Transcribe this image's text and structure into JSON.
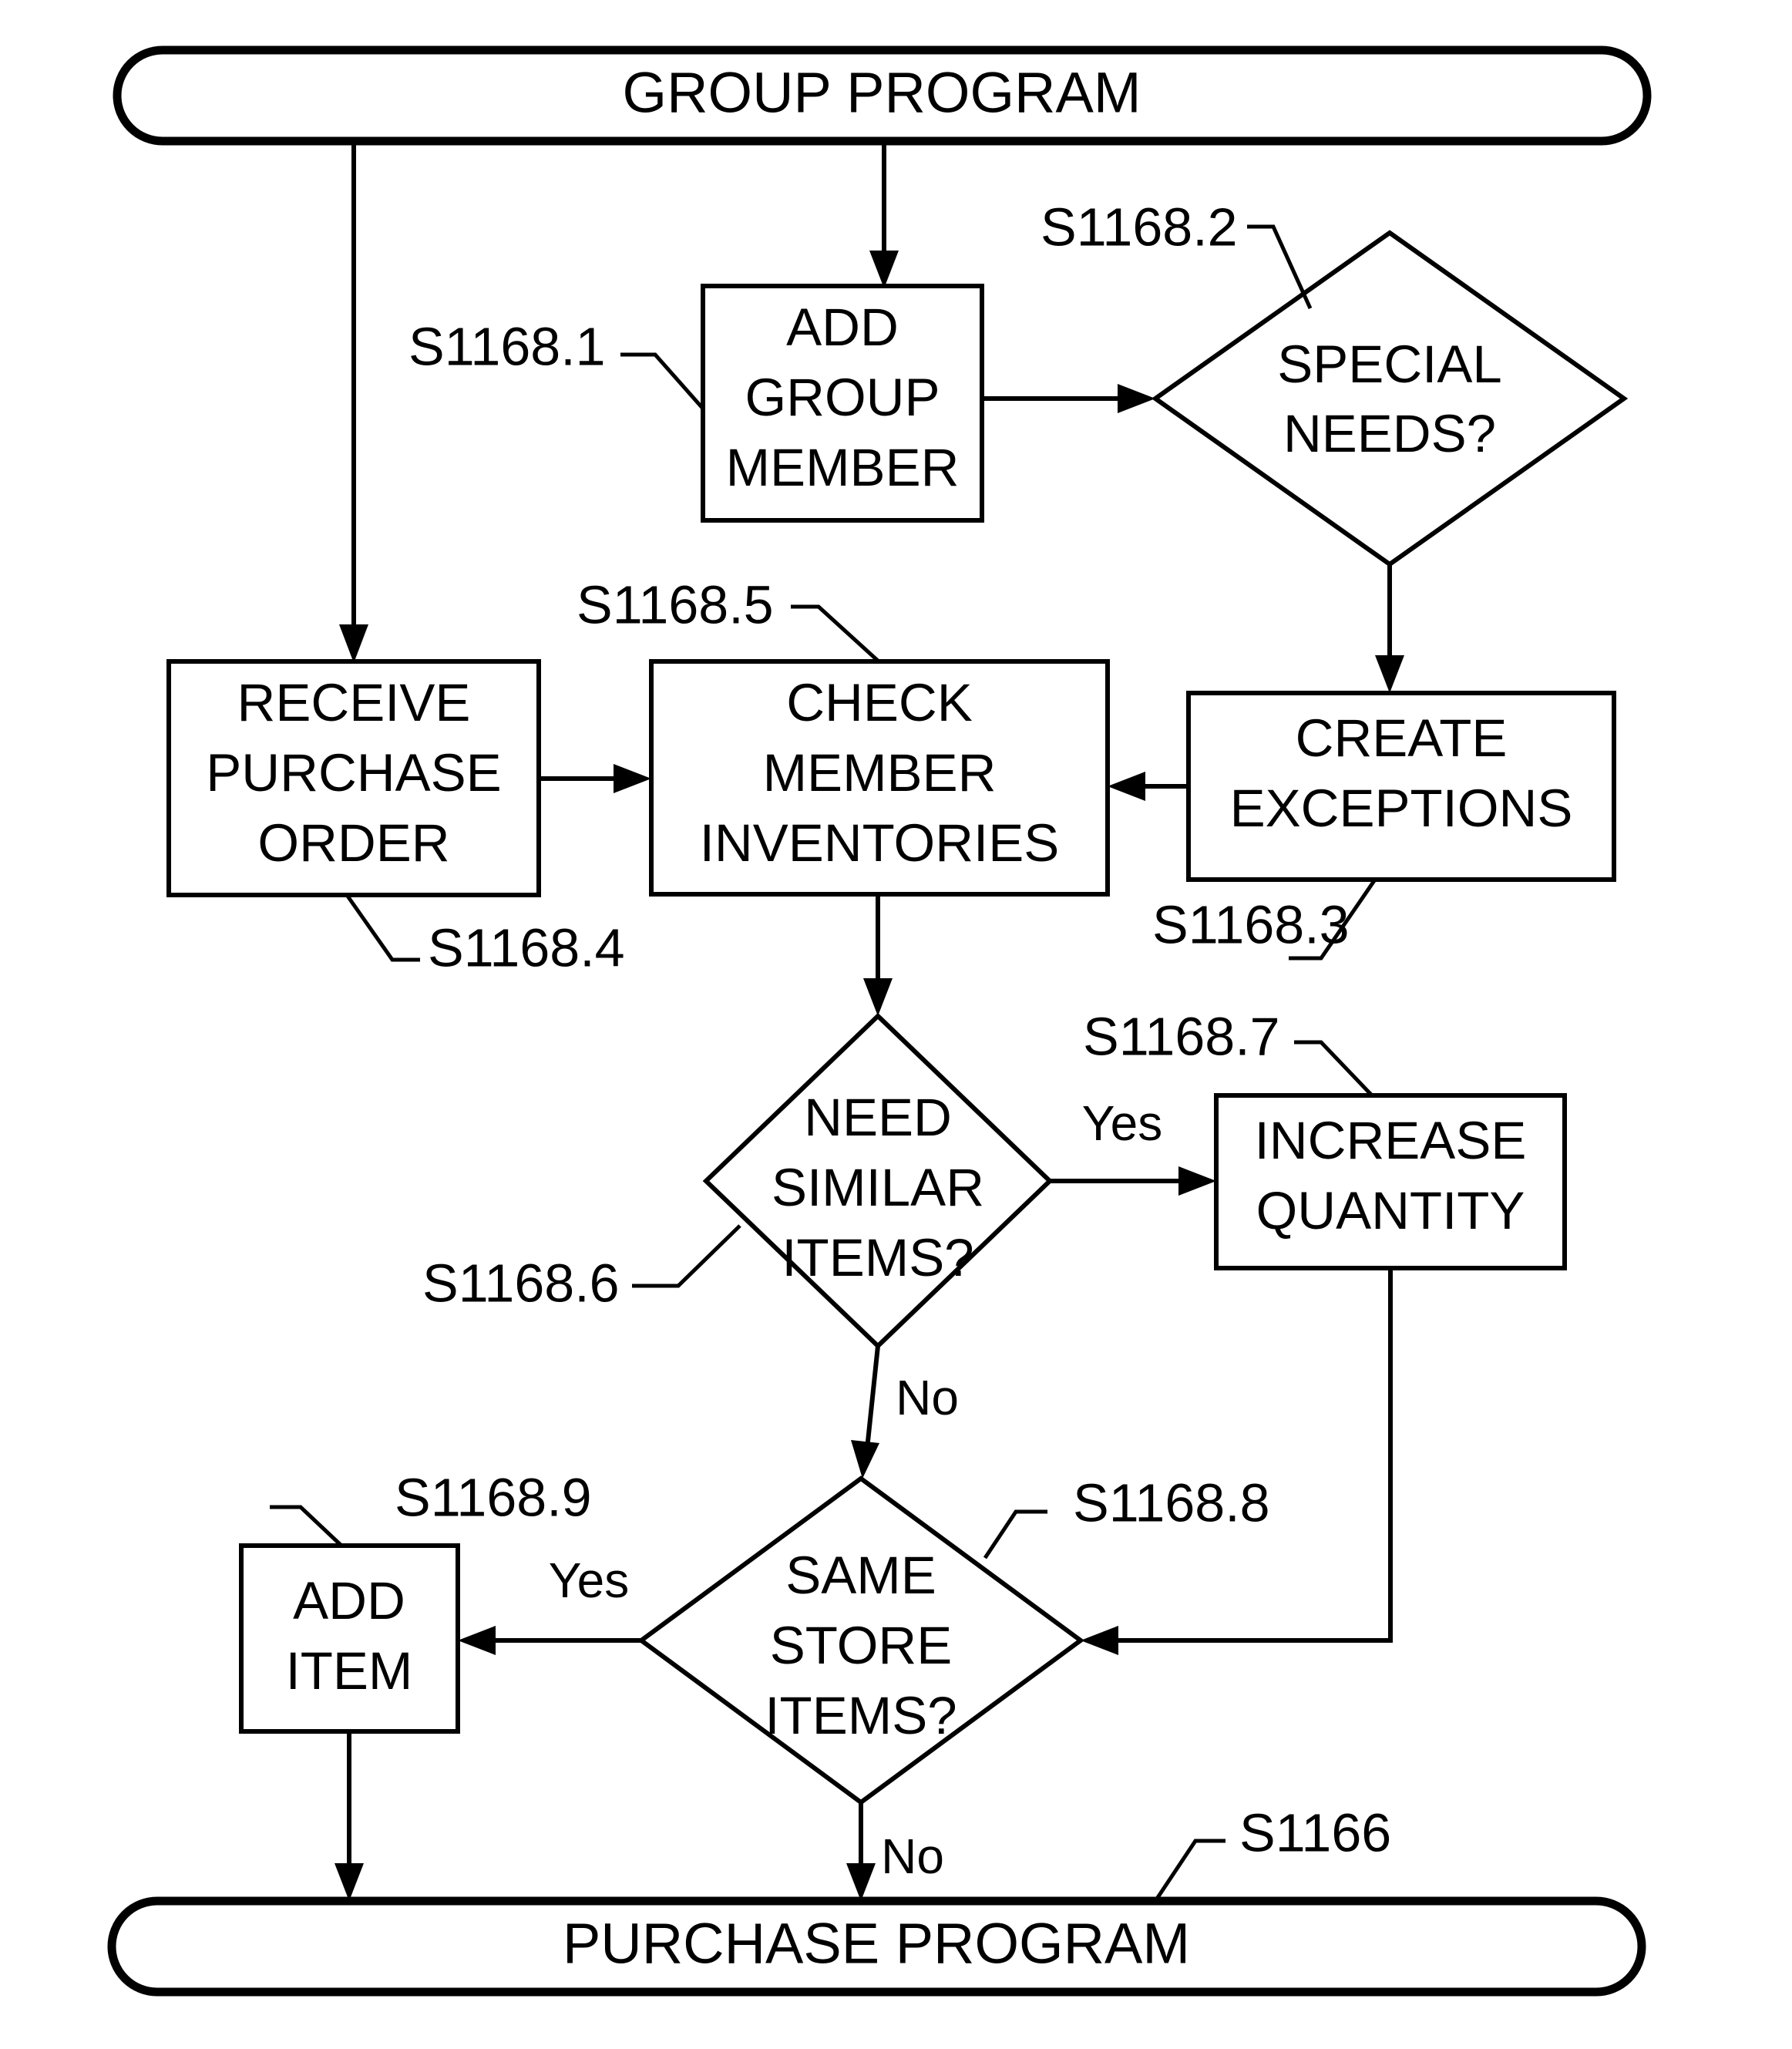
{
  "diagram": {
    "type": "flowchart",
    "title": "Group Program Flowchart",
    "background_color": "#ffffff",
    "line_color": "#000000"
  },
  "terminators": {
    "start": {
      "label": "GROUP PROGRAM"
    },
    "end": {
      "label": "PURCHASE PROGRAM",
      "ref": "S1166"
    }
  },
  "nodes": {
    "add_group_member": {
      "line1": "ADD",
      "line2": "GROUP",
      "line3": "MEMBER",
      "ref": "S1168.1"
    },
    "special_needs": {
      "line1": "SPECIAL",
      "line2": "NEEDS?",
      "ref": "S1168.2"
    },
    "create_exceptions": {
      "line1": "CREATE",
      "line2": "EXCEPTIONS",
      "ref": "S1168.3"
    },
    "receive_purchase_order": {
      "line1": "RECEIVE",
      "line2": "PURCHASE",
      "line3": "ORDER",
      "ref": "S1168.4"
    },
    "check_member_inventories": {
      "line1": "CHECK",
      "line2": "MEMBER",
      "line3": "INVENTORIES",
      "ref": "S1168.5"
    },
    "need_similar_items": {
      "line1": "NEED",
      "line2": "SIMILAR",
      "line3": "ITEMS?",
      "ref": "S1168.6"
    },
    "increase_quantity": {
      "line1": "INCREASE",
      "line2": "QUANTITY",
      "ref": "S1168.7"
    },
    "same_store_items": {
      "line1": "SAME",
      "line2": "STORE",
      "line3": "ITEMS?",
      "ref": "S1168.8"
    },
    "add_item": {
      "line1": "ADD",
      "line2": "ITEM",
      "ref": "S1168.9"
    }
  },
  "edge_labels": {
    "need_similar_yes": "Yes",
    "need_similar_no": "No",
    "same_store_yes": "Yes",
    "same_store_no": "No"
  }
}
